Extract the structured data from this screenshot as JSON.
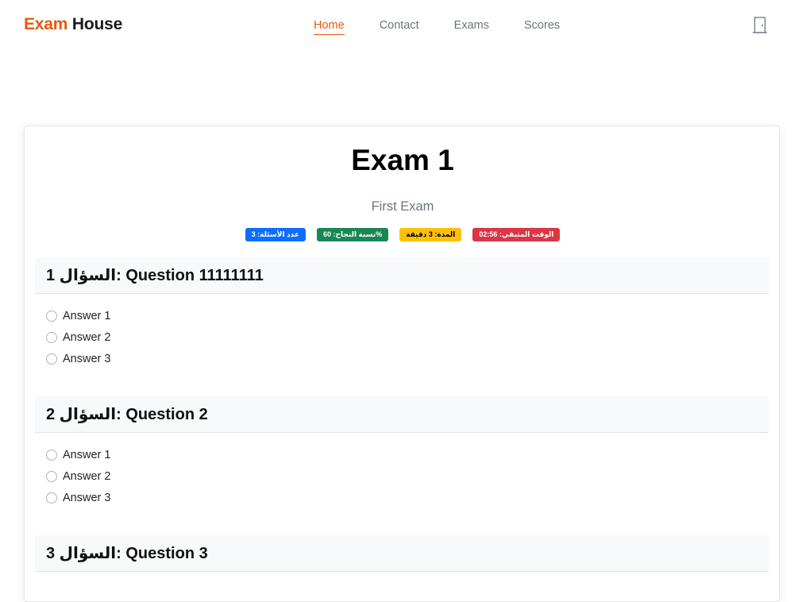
{
  "brand": {
    "part1": "Exam",
    "part2": "House"
  },
  "nav": {
    "items": [
      {
        "label": "Home",
        "active": true
      },
      {
        "label": "Contact",
        "active": false
      },
      {
        "label": "Exams",
        "active": false
      },
      {
        "label": "Scores",
        "active": false
      }
    ],
    "logout_icon": "door-icon"
  },
  "exam": {
    "title": "Exam 1",
    "subtitle": "First Exam",
    "badges": {
      "questions": "عدد الأسئلة: 3",
      "pass": "%نسبة النجاح: 60",
      "duration": "المدة: 3 دقيقة",
      "remaining": "الوقت المتبقي: 02:56"
    }
  },
  "questions": [
    {
      "header": "السؤال 1: Question 11111111",
      "answers": [
        "Answer 1",
        "Answer 2",
        "Answer 3"
      ]
    },
    {
      "header": "السؤال 2: Question 2",
      "answers": [
        "Answer 1",
        "Answer 2",
        "Answer 3"
      ]
    },
    {
      "header": "السؤال 3: Question 3",
      "answers": []
    }
  ],
  "colors": {
    "accent": "#e8590c",
    "badge_blue": "#0d6efd",
    "badge_green": "#198754",
    "badge_yellow": "#ffc107",
    "badge_red": "#dc3545"
  }
}
